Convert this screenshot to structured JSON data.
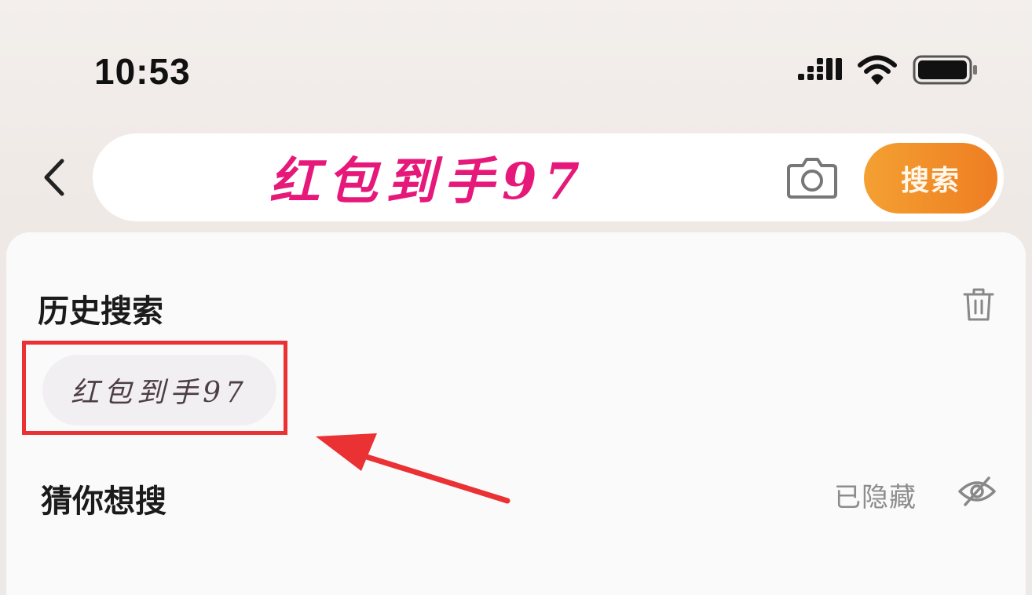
{
  "status_bar": {
    "time": "10:53",
    "icons": [
      "signal-icon",
      "wifi-icon",
      "battery-icon"
    ]
  },
  "search": {
    "query": "红包到手97",
    "submit_label": "搜索",
    "icons": [
      "chevron-left-icon",
      "camera-icon"
    ]
  },
  "history": {
    "title": "历史搜索",
    "items": [
      "红包到手97"
    ],
    "icon": "trash-icon"
  },
  "guess": {
    "title": "猜你想搜",
    "status": "已隐藏",
    "icon": "eye-off-icon"
  },
  "colors": {
    "query_text": "#e6197a",
    "accent": "#f28a28",
    "highlight": "#ea3134"
  }
}
